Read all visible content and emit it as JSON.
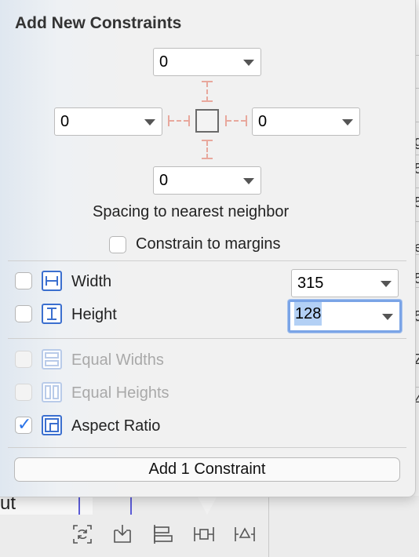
{
  "popover": {
    "title": "Add New Constraints",
    "spacing": {
      "top": "0",
      "left": "0",
      "right": "0",
      "bottom": "0",
      "caption": "Spacing to nearest neighbor"
    },
    "constrain_to_margins": {
      "label": "Constrain to margins",
      "checked": false
    },
    "width": {
      "label": "Width",
      "checked": false,
      "value": "315",
      "icon": "width-icon"
    },
    "height": {
      "label": "Height",
      "checked": false,
      "value": "128",
      "icon": "height-icon",
      "focused": true
    },
    "equal_widths": {
      "label": "Equal Widths",
      "checked": false,
      "enabled": false,
      "icon": "equal-widths-icon"
    },
    "equal_heights": {
      "label": "Equal Heights",
      "checked": false,
      "enabled": false,
      "icon": "equal-heights-icon"
    },
    "aspect_ratio": {
      "label": "Aspect Ratio",
      "checked": true,
      "icon": "aspect-ratio-icon"
    },
    "add_button": "Add 1 Constraint",
    "accent_color": "#3b6fcf",
    "strut_color": "#e8a89d"
  },
  "background": {
    "canvas_text": "ut",
    "right_fragments": [
      "g",
      "5",
      "5",
      "e",
      "5",
      "5",
      "Z",
      "4"
    ]
  },
  "toolbar": {
    "buttons": [
      "update-frames-icon",
      "embed-in-icon",
      "align-icon",
      "add-constraints-icon",
      "resolve-issues-icon"
    ]
  }
}
